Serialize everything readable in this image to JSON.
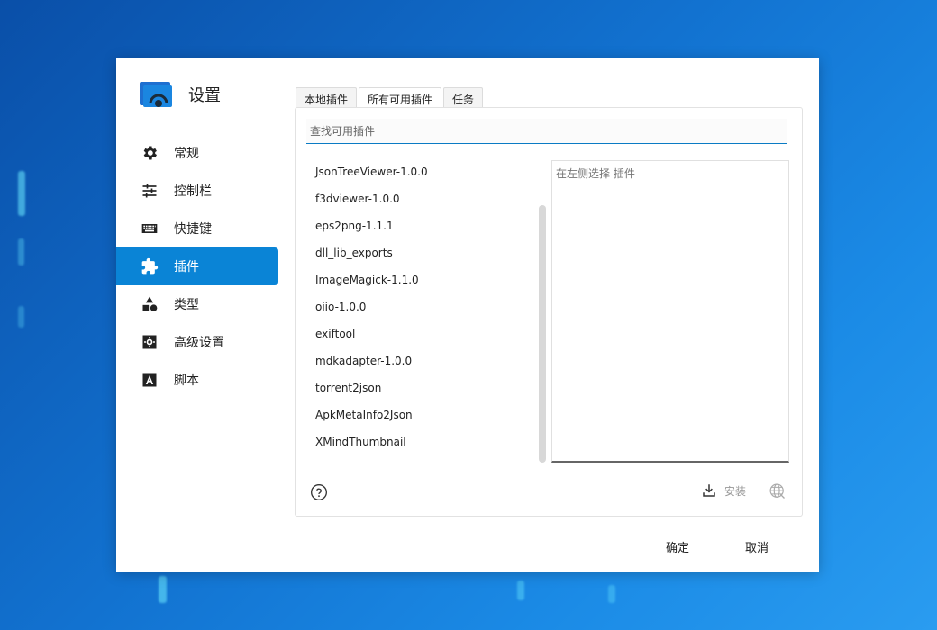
{
  "dialog": {
    "title": "设置"
  },
  "sidebar": {
    "items": [
      {
        "label": "常规",
        "icon": "gear-icon"
      },
      {
        "label": "控制栏",
        "icon": "sliders-icon"
      },
      {
        "label": "快捷键",
        "icon": "keyboard-icon"
      },
      {
        "label": "插件",
        "icon": "puzzle-icon",
        "active": true
      },
      {
        "label": "类型",
        "icon": "shapes-icon"
      },
      {
        "label": "高级设置",
        "icon": "advanced-gear-icon"
      },
      {
        "label": "脚本",
        "icon": "script-icon"
      }
    ]
  },
  "tabs": [
    {
      "label": "本地插件"
    },
    {
      "label": "所有可用插件",
      "active": true
    },
    {
      "label": "任务"
    }
  ],
  "search": {
    "placeholder": "查找可用插件",
    "value": ""
  },
  "plugins": [
    "JsonTreeViewer-1.0.0",
    "f3dviewer-1.0.0",
    "eps2png-1.1.1",
    "dll_lib_exports",
    "ImageMagick-1.1.0",
    "oiio-1.0.0",
    "exiftool",
    "mdkadapter-1.0.0",
    "torrent2json",
    "ApkMetaInfo2Json",
    "XMindThumbnail"
  ],
  "detail": {
    "placeholder": "在左侧选择 插件"
  },
  "actions": {
    "install_label": "安装",
    "ok_label": "确定",
    "cancel_label": "取消"
  },
  "colors": {
    "accent": "#0a84d6",
    "background": "#1272d0"
  }
}
